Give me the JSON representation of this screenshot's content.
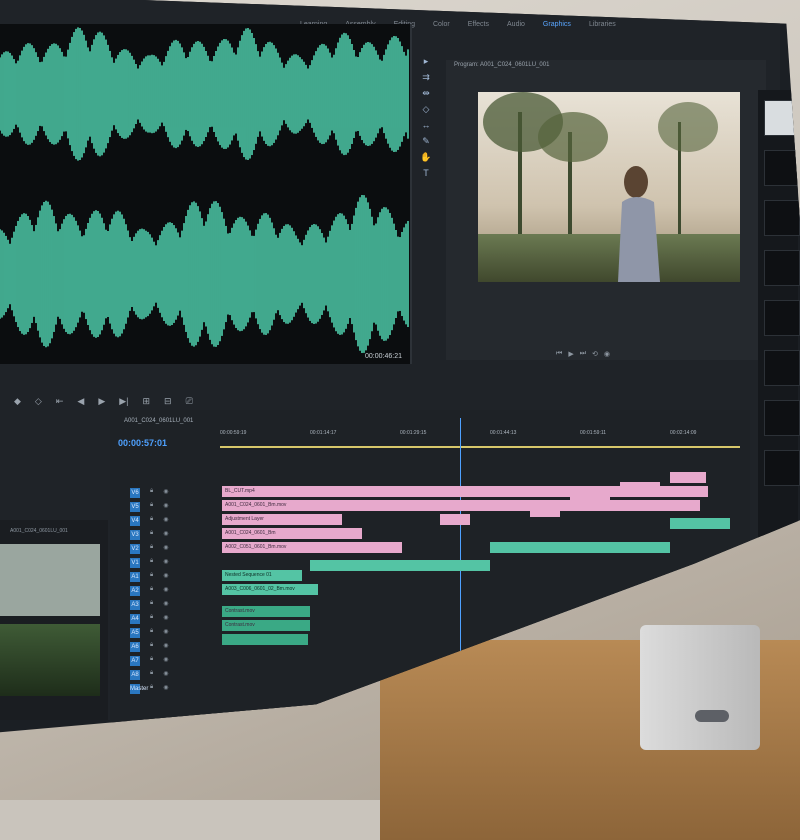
{
  "workspace_tabs": [
    "Learning",
    "Assembly",
    "Editing",
    "Color",
    "Effects",
    "Audio",
    "Graphics",
    "Libraries"
  ],
  "active_workspace": "Graphics",
  "audio_source": {
    "timecode": "00:00:46:21"
  },
  "program_monitor": {
    "title": "Program: A001_C024_0601LU_001"
  },
  "timeline": {
    "sequence_name": "A001_C024_0601LU_001",
    "timecode": "00:00:57:01",
    "ruler_labels": [
      "00:00:59:19",
      "00:01:14:17",
      "00:01:29:15",
      "00:01:44:13",
      "00:01:59:11",
      "00:02:14:09"
    ],
    "clip_labels": {
      "v4": "BL_CUT.mp4",
      "v3": "A001_C024_0601_Bm.mov",
      "v2": "Adjustment Layer",
      "v1a": "A001_C024_0601_Bm",
      "v1b": "A002_C051_0601_Bm.mov",
      "nested": "Nested Sequence 01",
      "v1c": "A003_C006_0601_02_Bm.mov",
      "a1": "Contrast.mov",
      "a2": "Contrast.mov"
    },
    "track_names": [
      "V6",
      "V5",
      "V4",
      "V3",
      "V2",
      "V1",
      "A1",
      "A2",
      "A3",
      "A4",
      "A5",
      "A6",
      "A7",
      "A8",
      "Master"
    ]
  },
  "media_panel": {
    "label": "A001_C024_0601LU_001"
  },
  "colors": {
    "accent": "#4ea1ff",
    "waveform": "#4fd0ad",
    "clip_pink": "#e7a9cc",
    "clip_green": "#54c4a4"
  }
}
